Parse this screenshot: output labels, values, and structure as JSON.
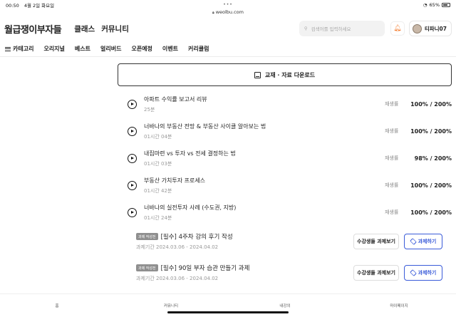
{
  "status_bar": {
    "time": "00:50",
    "date": "4월 2일 화요일",
    "battery": "65%"
  },
  "browser": {
    "url": "weolbu.com"
  },
  "header": {
    "logo": "월급쟁이부자들",
    "nav": [
      "클래스",
      "커뮤니티"
    ],
    "search_placeholder": "검색어를 입력하세요",
    "username": "티파니07"
  },
  "category_nav": {
    "menu_label": "카테고리",
    "items": [
      "오리지널",
      "베스트",
      "얼리버드",
      "오픈예정",
      "이벤트",
      "커리큘럼"
    ]
  },
  "download_button": "교재 · 자료 다운로드",
  "lectures": [
    {
      "title": "아파트 수익률 보고서 리뷰",
      "duration": "25분",
      "rate_label": "재생률",
      "rate": "100% / 200%"
    },
    {
      "title": "너바나의 부동산 전망 & 부동산 사이클 알아보는 법",
      "duration": "01시간 04분",
      "rate_label": "재생률",
      "rate": "100% / 200%"
    },
    {
      "title": "내집마련 vs 투자 vs 전세 결정하는 법",
      "duration": "01시간 03분",
      "rate_label": "재생률",
      "rate": "98% / 200%"
    },
    {
      "title": "부동산 가치투자 프로세스",
      "duration": "01시간 42분",
      "rate_label": "재생률",
      "rate": "100% / 200%"
    },
    {
      "title": "너바나의 실전투자 사례 (수도권, 지방)",
      "duration": "01시간 24분",
      "rate_label": "재생률",
      "rate": "100% / 200%"
    }
  ],
  "assignments": [
    {
      "badge": "과제 작성전",
      "title": "[필수] 4주차 강의 후기 작성",
      "period": "과제기간 2024.03.06 - 2024.04.02",
      "view_label": "수강생들 과제보기",
      "do_label": "과제하기"
    },
    {
      "badge": "과제 작성전",
      "title": "[필수] 90일 부자 습관 만들기 과제",
      "period": "과제기간 2024.03.06 - 2024.04.02",
      "view_label": "수강생들 과제보기",
      "do_label": "과제하기"
    }
  ],
  "bottom_tabs": [
    "홈",
    "커뮤니티",
    "내강의",
    "마이페이지"
  ],
  "colors": {
    "accent": "#3a5bd9",
    "bell": "#f47d30",
    "badge": "#8f8f8f"
  }
}
